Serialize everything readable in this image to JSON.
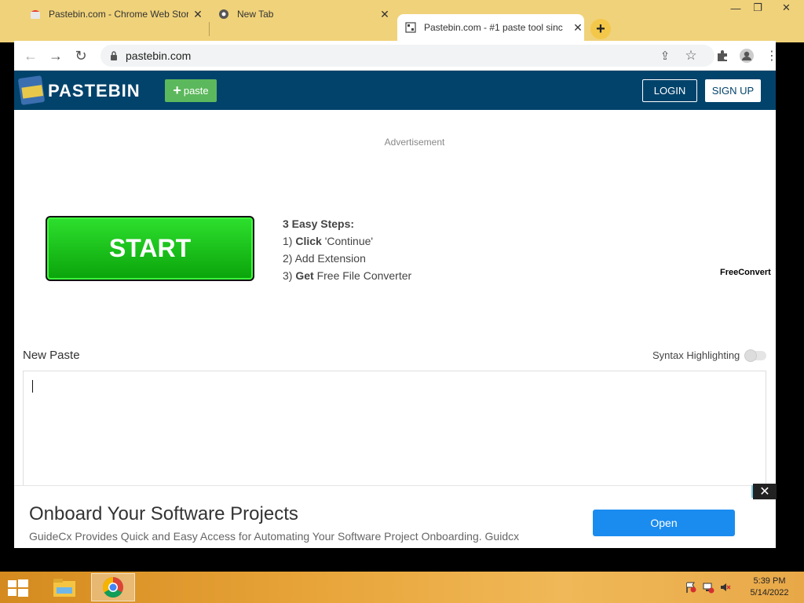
{
  "browser": {
    "tabs": [
      {
        "title": "Pastebin.com - Chrome Web Stor",
        "active": false
      },
      {
        "title": "New Tab",
        "active": false
      },
      {
        "title": "Pastebin.com - #1 paste tool sinc",
        "active": true
      }
    ],
    "url": "pastebin.com"
  },
  "header": {
    "brand": "PASTEBIN",
    "new_paste_label": "paste",
    "login_label": "LOGIN",
    "signup_label": "SIGN UP",
    "bg_color": "#02436b",
    "accent_color": "#5cb85c"
  },
  "ad_top": {
    "label": "Advertisement",
    "start_label": "START",
    "steps_heading": "3 Easy Steps:",
    "steps": [
      {
        "num": "1)",
        "bold": "Click",
        "rest": "'Continue'"
      },
      {
        "num": "2)",
        "bold": "",
        "rest": "Add Extension"
      },
      {
        "num": "3)",
        "bold": "Get",
        "rest": "Free File Converter"
      }
    ],
    "sponsor": "FreeConvert"
  },
  "paste": {
    "label": "New Paste",
    "syntax_label": "Syntax Highlighting",
    "syntax_enabled": false,
    "content": ""
  },
  "banner_ad": {
    "title": "Onboard Your Software Projects",
    "subtitle": "GuideCx Provides Quick and Easy Access for Automating Your Software Project Onboarding. Guidcx",
    "button_label": "Open",
    "button_color": "#1a8cf0"
  },
  "taskbar": {
    "time": "5:39 PM",
    "date": "5/14/2022"
  }
}
